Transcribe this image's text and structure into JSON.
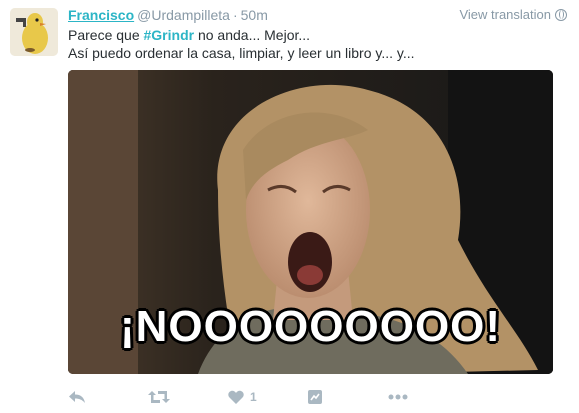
{
  "tweet": {
    "author_name": "Francisco",
    "handle": "@Urdampilleta",
    "separator": "·",
    "timestamp": "50m",
    "translate_label": "View translation",
    "text_line1_before": "Parece que ",
    "hashtag": "#Grindr",
    "text_line1_after": " no anda... Mejor...",
    "text_line2": "Así puedo ordenar la casa, limpiar, y leer un libro y... y...",
    "image_caption": "¡NOOOOOOOOO!",
    "like_count": "1"
  },
  "icons": {
    "reply": "reply-icon",
    "retweet": "retweet-icon",
    "like": "heart-icon",
    "analytics": "analytics-icon",
    "more": "more-icon",
    "translate": "globe-icon"
  },
  "colors": {
    "link": "#2cb5c6",
    "muted": "#8899a6",
    "action": "#aab8c2",
    "text": "#292f33"
  }
}
